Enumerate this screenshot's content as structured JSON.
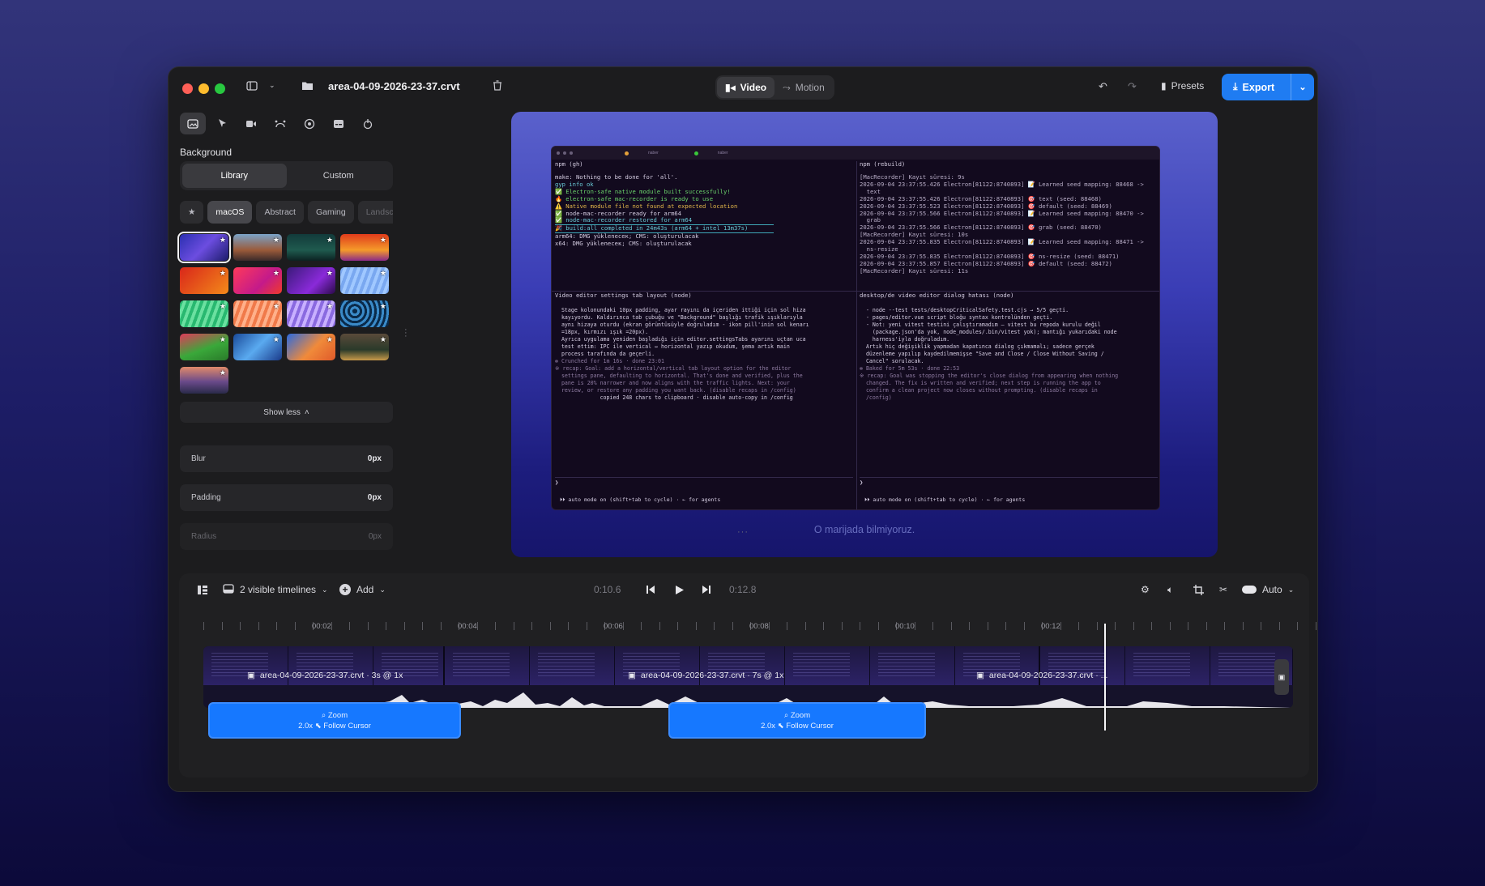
{
  "titlebar": {
    "filename": "area-04-09-2026-23-37.crvt",
    "mode_tabs": [
      {
        "label": "Video",
        "active": true,
        "icon": "video-icon"
      },
      {
        "label": "Motion",
        "active": false,
        "icon": "motion-icon"
      }
    ],
    "presets_label": "Presets",
    "export_label": "Export"
  },
  "sidebar": {
    "section_title": "Background",
    "source_tabs": [
      {
        "label": "Library",
        "active": true
      },
      {
        "label": "Custom",
        "active": false
      }
    ],
    "categories": [
      "macOS",
      "Abstract",
      "Gaming",
      "Landsc"
    ],
    "active_category": "macOS",
    "show_less_label": "Show less",
    "fields": [
      {
        "label": "Blur",
        "value": "0px"
      },
      {
        "label": "Padding",
        "value": "0px"
      },
      {
        "label": "Radius",
        "value": "0px"
      }
    ]
  },
  "preview": {
    "caption": "O marijada bilmiyoruz.",
    "terminal": {
      "tabs": [
        "naber",
        "naber"
      ],
      "pane_headers": [
        "npm (gh)",
        "npm (rebuild)",
        "Video editor settings tab layout (node)",
        "desktop/de video editor dialog hatası (node)"
      ],
      "left_top": [
        "make: Nothing to be done for 'all'.",
        "gyp info ok",
        "",
        "✅ Electron-safe native module built successfully!",
        "🔥 electron-safe mac-recorder is ready to use",
        "⚠️ Native module file not found at expected location",
        "✅ node-mac-recorder ready for arm64",
        "✅ node-mac-recorder restored for arm64",
        "",
        "🎉 build:all completed in 24m43s (arm64 + intel 13m37s)",
        "",
        "arm64: DMG yükleneceк; CMS: oluşturulacak",
        "x64: DMG yükleneceк; CMS: oluşturulacak"
      ],
      "right_top": [
        "[MacRecorder] Kayıt süresi: 9s",
        "2026-09-04 23:37:55.426 Electron[81122:8740893] 📝 Learned seed mapping: 88468 ->",
        "  text",
        "2026-09-04 23:37:55.426 Electron[81122:8740893] 🎯 text (seed: 88468)",
        "2026-09-04 23:37:55.523 Electron[81122:8740893] 🎯 default (seed: 88469)",
        "2026-09-04 23:37:55.566 Electron[81122:8740893] 📝 Learned seed mapping: 88470 ->",
        "  grab",
        "2026-09-04 23:37:55.566 Electron[81122:8740893] 🎯 grab (seed: 88470)",
        "[MacRecorder] Kayıt süresi: 10s",
        "2026-09-04 23:37:55.835 Electron[81122:8740893] 📝 Learned seed mapping: 88471 ->",
        "  ns-resize",
        "2026-09-04 23:37:55.835 Electron[81122:8740893] 🎯 ns-resize (seed: 88471)",
        "2026-09-04 23:37:55.857 Electron[81122:8740893] 🎯 default (seed: 88472)",
        "[MacRecorder] Kayıt süresi: 11s"
      ],
      "left_bottom": [
        "  Stage kolonundaki 10px padding, ayar rayını da içeriden ittiği için sol hiza",
        "  kayıyordu. Kaldırınca tab çubuğu ve \"Background\" başlığı trafik ışıklarıyla",
        "  aynı hizaya oturdu (ekran görüntüsüyle doğruladım - ikon pill'inin sol kenarı",
        "  =18px, kırmızı ışık =20px).",
        "",
        "  Ayrıca uygulama yeniden başladığı için editor.settingsTabs ayarını uçtan uca",
        "  test ettim: IPC ile vertical ↔ horizontal yazıp okudum, şema artık main",
        "  process tarafında da geçerli.",
        "",
        "✻ Crunched for 1m 16s · done 23:01",
        "",
        "※ recap: Goal: add a horizontal/vertical tab layout option for the editor",
        "  settings pane, defaulting to horizontal. That's done and verified, plus the",
        "  pane is 20% narrower and now aligns with the traffic lights. Next: your",
        "  review, or restore any padding you want back. (disable recaps in /config)",
        "              copied 248 chars to clipboard · disable auto-copy in /config"
      ],
      "right_bottom": [
        "  - node --test tests/desktopCriticalSafety.test.cjs → 5/5 geçti.",
        "  - pages/editor.vue script bloğu syntax kontrolünden geçti.",
        "  - Not: yeni vitest testini çalıştıramadım — vitest bu repoda kurulu değil",
        "    (package.json'da yok, node_modules/.bin/vitest yok); mantığı yukarıdaki node",
        "    harness'iyla doğruladım.",
        "",
        "  Artık hiç değişiklik yapmadan kapatınca dialog çıkmamalı; sadece gerçek",
        "  düzenleme yapılıp kaydedilmemişse \"Save and Close / Close Without Saving /",
        "  Cancel\" sorulacak.",
        "",
        "✻ Baked for 5m 53s · done 22:53",
        "",
        "※ recap: Goal was stopping the editor's close dialog from appearing when nothing",
        "  changed. The fix is written and verified; next step is running the app to",
        "  confirm a clean project now closes without prompting. (disable recaps in",
        "  /config)"
      ],
      "prompt": "❯",
      "footer": "⏵⏵ auto mode on (shift+tab to cycle) · ← for agents"
    }
  },
  "timeline": {
    "visible_label": "2 visible timelines",
    "add_label": "Add",
    "current_time": "0:10.6",
    "total_time": "0:12.8",
    "speed_label": "Auto",
    "ruler_labels": [
      "00:02",
      "00:04",
      "00:06",
      "00:08",
      "00:10",
      "00:12"
    ],
    "clips": [
      {
        "label": "area-04-09-2026-23-37.crvt · 3s @ 1x"
      },
      {
        "label": "area-04-09-2026-23-37.crvt · 7s @ 1x"
      },
      {
        "label": "area-04-09-2026-23-37.crvt · ..."
      }
    ],
    "zooms": [
      {
        "title": "Zoom",
        "detail_scale": "2.0x",
        "detail_mode": "Follow Cursor"
      },
      {
        "title": "Zoom",
        "detail_scale": "2.0x",
        "detail_mode": "Follow Cursor"
      }
    ],
    "playhead_time_s": 10.6
  },
  "colors": {
    "accent": "#1f7cf2",
    "zoom_block": "#1678ff",
    "window_bg": "#1c1c1e"
  }
}
